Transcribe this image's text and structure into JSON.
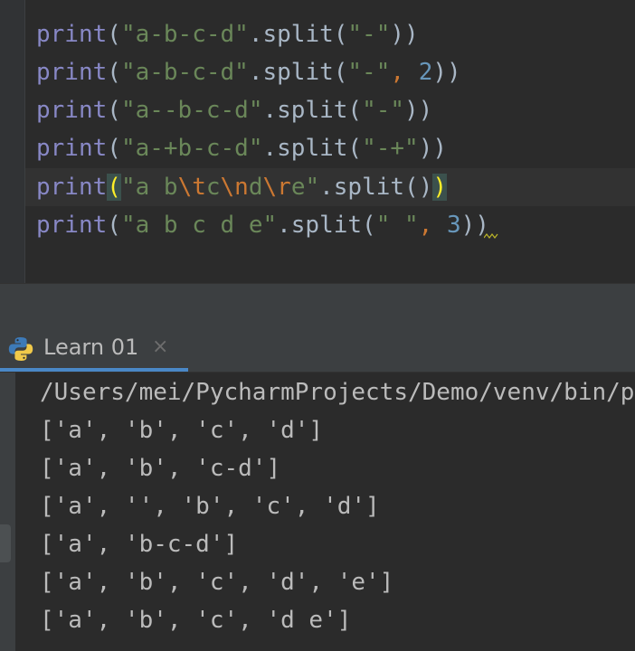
{
  "editor": {
    "lines": [
      {
        "fn": "print",
        "open": "(",
        "str": "\"a-b-c-d\"",
        "method": ".split(",
        "arg": "\"-\"",
        "close": "))"
      },
      {
        "fn": "print",
        "open": "(",
        "str": "\"a-b-c-d\"",
        "method": ".split(",
        "arg": "\"-\"",
        "sep": ", ",
        "num": "2",
        "close": "))"
      },
      {
        "fn": "print",
        "open": "(",
        "str": "\"a--b-c-d\"",
        "method": ".split(",
        "arg": "\"-\"",
        "close": "))"
      },
      {
        "fn": "print",
        "open": "(",
        "str": "\"a-+b-c-d\"",
        "method": ".split(",
        "arg": "\"-+\"",
        "close": "))"
      },
      {
        "fn": "print",
        "open": "(",
        "s1": "\"a b",
        "e1": "\\t",
        "s2": "c",
        "e2": "\\n",
        "s3": "d",
        "e3": "\\r",
        "s4": "e\"",
        "method": ".split()",
        "close": ")"
      },
      {
        "fn": "print",
        "open": "(",
        "str": "\"a b c d e\"",
        "method": ".split(",
        "arg": "\" \"",
        "sep": ", ",
        "num": "3",
        "close": "))"
      }
    ]
  },
  "run_panel": {
    "tab_label": "Learn 01",
    "close_glyph": "×"
  },
  "console": {
    "lines": [
      "/Users/mei/PycharmProjects/Demo/venv/bin/p",
      "['a', 'b', 'c', 'd']",
      "['a', 'b', 'c-d']",
      "['a', '', 'b', 'c', 'd']",
      "['a', 'b-c-d']",
      "['a', 'b', 'c', 'd', 'e']",
      "['a', 'b', 'c', 'd e']"
    ]
  },
  "colors": {
    "background": "#2b2b2b",
    "keyword": "#8888c6",
    "string": "#6a8759",
    "number": "#6897bb",
    "escape": "#cc7832",
    "brace_highlight": "#ffef28",
    "tab_underline": "#4a88c7"
  }
}
